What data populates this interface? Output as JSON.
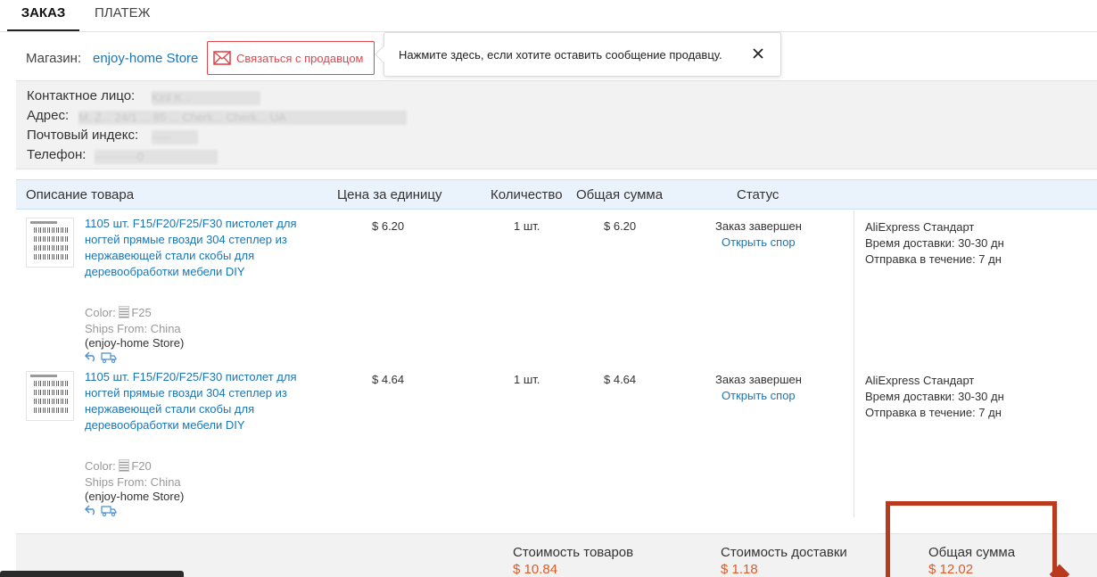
{
  "tabs": [
    {
      "label": "ЗАКАЗ",
      "active": true
    },
    {
      "label": "ПЛАТЕЖ",
      "active": false
    }
  ],
  "store": {
    "label": "Магазин:",
    "name": "enjoy-home Store",
    "contact_button": "Связаться с продавцом"
  },
  "tooltip": {
    "text": "Нажмите здесь, если хотите оставить сообщение продавцу."
  },
  "address": {
    "contact_label": "Контактное лицо:",
    "contact_value": "Kiril K...",
    "address_label": "Адрес:",
    "address_value": "M. Z... 24/1 ... 85 ... Cherk... Cherk... UA",
    "zip_label": "Почтовый индекс:",
    "zip_value": "-----",
    "phone_label": "Телефон:",
    "phone_value": "-----------0"
  },
  "table": {
    "headers": {
      "description": "Описание товара",
      "unit_price": "Цена за единицу",
      "quantity": "Количество",
      "total": "Общая сумма",
      "status": "Статус"
    },
    "items": [
      {
        "title": "1105 шт. F15/F20/F25/F30 пистолет для ногтей прямые гвозди 304 степлер из нержавеющей стали скобы для деревообработки мебели DIY",
        "color_label": "Color:",
        "color_value": "F25",
        "ships_from": "Ships From: China",
        "store": "(enjoy-home Store)",
        "unit_price": "$ 6.20",
        "quantity": "1 шт.",
        "total": "$ 6.20",
        "status": "Заказ завершен",
        "dispute": "Открыть спор",
        "shipping_method": "AliExpress Стандарт",
        "delivery_time": "Время доставки: 30-30 дн",
        "dispatch_time": "Отправка в течение: 7 дн"
      },
      {
        "title": "1105 шт. F15/F20/F25/F30 пистолет для ногтей прямые гвозди 304 степлер из нержавеющей стали скобы для деревообработки мебели DIY",
        "color_label": "Color:",
        "color_value": "F20",
        "ships_from": "Ships From: China",
        "store": "(enjoy-home Store)",
        "unit_price": "$ 4.64",
        "quantity": "1 шт.",
        "total": "$ 4.64",
        "status": "Заказ завершен",
        "dispute": "Открыть спор",
        "shipping_method": "AliExpress Стандарт",
        "delivery_time": "Время доставки: 30-30 дн",
        "dispatch_time": "Отправка в течение: 7 дн"
      }
    ]
  },
  "summary": {
    "goods_label": "Стоимость товаров",
    "goods_value": "$ 10.84",
    "shipping_label": "Стоимость доставки",
    "shipping_value": "$ 1.18",
    "total_label": "Общая сумма",
    "total_value": "$ 12.02"
  },
  "colors": {
    "link": "#1a76b5",
    "accent_red": "#e0474c",
    "price_orange": "#e05a24",
    "highlight_box": "#b93a1c",
    "header_bg": "#eaf2fb"
  },
  "icons": [
    "mail-icon",
    "close-icon",
    "return-icon",
    "delivery-truck-icon",
    "color-swatch-icon",
    "product-thumbnail"
  ]
}
